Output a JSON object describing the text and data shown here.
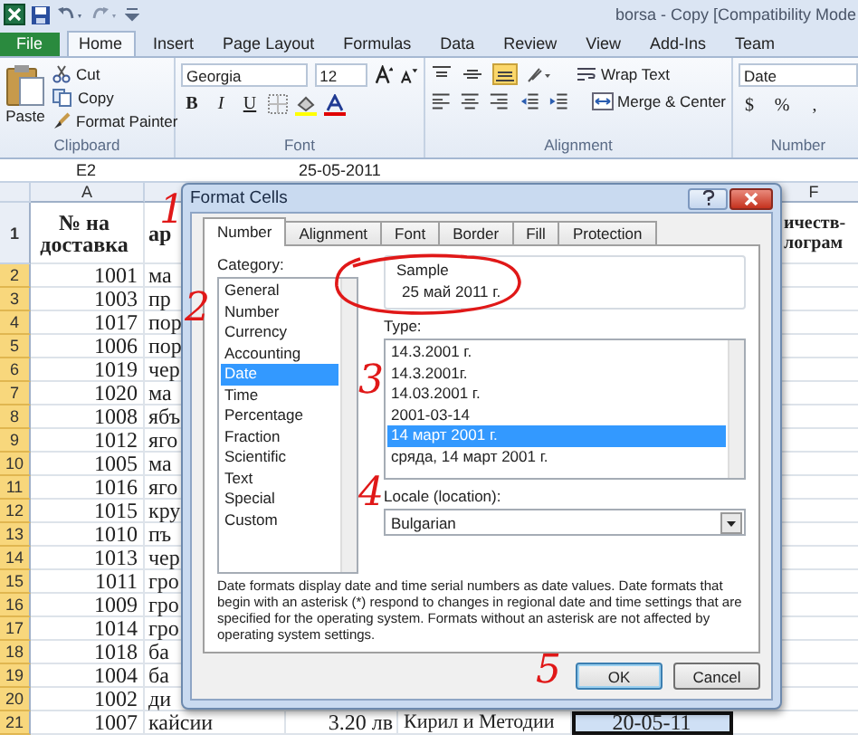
{
  "titlebar": {
    "title": "borsa - Copy  [Compatibility Mode"
  },
  "ribbon_tabs": [
    {
      "label": "File",
      "kind": "file",
      "selected": false
    },
    {
      "label": "Home",
      "kind": "tab",
      "selected": true
    },
    {
      "label": "Insert",
      "kind": "tab",
      "selected": false
    },
    {
      "label": "Page Layout",
      "kind": "tab",
      "selected": false
    },
    {
      "label": "Formulas",
      "kind": "tab",
      "selected": false
    },
    {
      "label": "Data",
      "kind": "tab",
      "selected": false
    },
    {
      "label": "Review",
      "kind": "tab",
      "selected": false
    },
    {
      "label": "View",
      "kind": "tab",
      "selected": false
    },
    {
      "label": "Add-Ins",
      "kind": "tab",
      "selected": false
    },
    {
      "label": "Team",
      "kind": "tab",
      "selected": false
    }
  ],
  "clipboard": {
    "paste": "Paste",
    "cut": "Cut",
    "copy": "Copy",
    "format_painter": "Format Painter",
    "group": "Clipboard"
  },
  "font": {
    "name": "Georgia",
    "size": "12",
    "bold": "B",
    "italic": "I",
    "underline": "U",
    "group": "Font"
  },
  "alignment": {
    "wrap": "Wrap Text",
    "merge": "Merge & Center",
    "group": "Alignment"
  },
  "number": {
    "format": "Date",
    "currency": "$",
    "percent": "%",
    "comma": ",",
    "group": "Number"
  },
  "formula_bar": {
    "cell": "E2",
    "value": "25-05-2011"
  },
  "sheet": {
    "column_headers": [
      "A",
      "F"
    ],
    "rows": [
      {
        "num": "1",
        "selected": false,
        "a": "№ на\nдоставка",
        "b": "ар",
        "f": "ичеств-\nлограм"
      },
      {
        "num": "2",
        "selected": true,
        "a": "1001",
        "b": "ма"
      },
      {
        "num": "3",
        "selected": true,
        "a": "1003",
        "b": "пр"
      },
      {
        "num": "4",
        "selected": true,
        "a": "1017",
        "b": "пор"
      },
      {
        "num": "5",
        "selected": true,
        "a": "1006",
        "b": "пор"
      },
      {
        "num": "6",
        "selected": true,
        "a": "1019",
        "b": "чер"
      },
      {
        "num": "7",
        "selected": true,
        "a": "1020",
        "b": "ма"
      },
      {
        "num": "8",
        "selected": true,
        "a": "1008",
        "b": "ябъ"
      },
      {
        "num": "9",
        "selected": true,
        "a": "1012",
        "b": "яго"
      },
      {
        "num": "10",
        "selected": true,
        "a": "1005",
        "b": "ма"
      },
      {
        "num": "11",
        "selected": true,
        "a": "1016",
        "b": "яго"
      },
      {
        "num": "12",
        "selected": true,
        "a": "1015",
        "b": "кру"
      },
      {
        "num": "13",
        "selected": true,
        "a": "1010",
        "b": "пъ"
      },
      {
        "num": "14",
        "selected": true,
        "a": "1013",
        "b": "чер"
      },
      {
        "num": "15",
        "selected": true,
        "a": "1011",
        "b": "гро"
      },
      {
        "num": "16",
        "selected": true,
        "a": "1009",
        "b": "гро"
      },
      {
        "num": "17",
        "selected": true,
        "a": "1014",
        "b": "гро"
      },
      {
        "num": "18",
        "selected": true,
        "a": "1018",
        "b": "ба"
      },
      {
        "num": "19",
        "selected": true,
        "a": "1004",
        "b": "ба"
      },
      {
        "num": "20",
        "selected": true,
        "a": "1002",
        "b": "ди"
      },
      {
        "num": "21",
        "selected": true,
        "a": "1007",
        "b": "кайсии",
        "c": "3.20 лв",
        "d": "Кирил и Методии",
        "e": "20-05-11",
        "cursor": true
      }
    ]
  },
  "dialog": {
    "title": "Format Cells",
    "tabs": [
      {
        "label": "Number",
        "selected": true
      },
      {
        "label": "Alignment",
        "selected": false
      },
      {
        "label": "Font",
        "selected": false
      },
      {
        "label": "Border",
        "selected": false
      },
      {
        "label": "Fill",
        "selected": false
      },
      {
        "label": "Protection",
        "selected": false
      }
    ],
    "category_label": "Category:",
    "categories": [
      {
        "label": "General",
        "selected": false
      },
      {
        "label": "Number",
        "selected": false
      },
      {
        "label": "Currency",
        "selected": false
      },
      {
        "label": "Accounting",
        "selected": false
      },
      {
        "label": "Date",
        "selected": true
      },
      {
        "label": "Time",
        "selected": false
      },
      {
        "label": "Percentage",
        "selected": false
      },
      {
        "label": "Fraction",
        "selected": false
      },
      {
        "label": "Scientific",
        "selected": false
      },
      {
        "label": "Text",
        "selected": false
      },
      {
        "label": "Special",
        "selected": false
      },
      {
        "label": "Custom",
        "selected": false
      }
    ],
    "sample_label": "Sample",
    "sample": "25 май 2011 г.",
    "type_label": "Type:",
    "types": [
      {
        "label": "14.3.2001 г.",
        "selected": false
      },
      {
        "label": "14.3.2001г.",
        "selected": false
      },
      {
        "label": "14.03.2001 г.",
        "selected": false
      },
      {
        "label": "2001-03-14",
        "selected": false
      },
      {
        "label": "14 март 2001 г.",
        "selected": true
      },
      {
        "label": "сряда, 14 март 2001 г.",
        "selected": false
      }
    ],
    "locale_label": "Locale (location):",
    "locale": "Bulgarian",
    "description": "Date formats display date and time serial numbers as date values.  Date formats that begin with an asterisk (*) respond to changes in regional date and time settings that are specified for the operating system. Formats without an asterisk are not affected by operating system settings.",
    "buttons": [
      {
        "label": "OK",
        "kind": "default"
      },
      {
        "label": "Cancel",
        "kind": "normal"
      }
    ]
  },
  "annotations": [
    {
      "text": "1"
    },
    {
      "text": "2"
    },
    {
      "text": "3"
    },
    {
      "text": "4"
    },
    {
      "text": "5"
    }
  ]
}
